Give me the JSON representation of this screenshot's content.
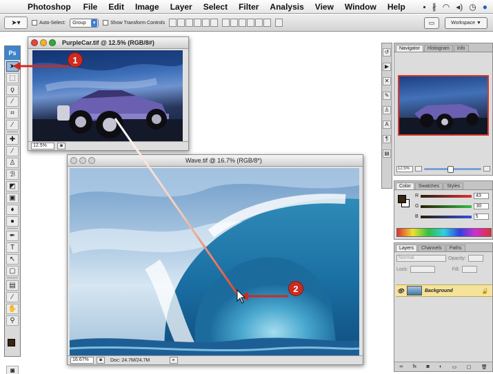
{
  "menubar": {
    "app_name": "Photoshop",
    "items": [
      "File",
      "Edit",
      "Image",
      "Layer",
      "Select",
      "Filter",
      "Analysis",
      "View",
      "Window",
      "Help"
    ],
    "status_icons": [
      "display-icon",
      "bluetooth-icon",
      "wifi-icon",
      "volume-icon",
      "clock-icon",
      "spotlight-icon"
    ]
  },
  "options_bar": {
    "auto_select_label": "Auto-Select:",
    "auto_select_value": "Group",
    "show_transform_label": "Show Transform Controls",
    "workspace_label": "Workspace ▼"
  },
  "toolbox": {
    "logo": "Ps",
    "tools": [
      "move-tool",
      "marquee-tool",
      "lasso-tool",
      "magic-wand-tool",
      "crop-tool",
      "slice-tool",
      "healing-brush-tool",
      "brush-tool",
      "clone-stamp-tool",
      "history-brush-tool",
      "eraser-tool",
      "gradient-tool",
      "blur-tool",
      "dodge-tool",
      "pen-tool",
      "type-tool",
      "path-selection-tool",
      "shape-tool",
      "notes-tool",
      "eyedropper-tool",
      "hand-tool",
      "zoom-tool"
    ],
    "active_tool": "move-tool"
  },
  "windows": {
    "car": {
      "title": "PurpleCar.tif @ 12.5% (RGB/8#)",
      "zoom": "12.5%"
    },
    "wave": {
      "title": "Wave.tif @ 16.7% (RGB/8*)",
      "zoom": "16.67%",
      "doc_info": "Doc: 24.7M/24.7M"
    }
  },
  "navigator": {
    "tabs": [
      "Navigator",
      "Histogram",
      "Info"
    ],
    "zoom": "12.5%"
  },
  "color_panel": {
    "tabs": [
      "Color",
      "Swatches",
      "Styles"
    ],
    "channels": [
      {
        "label": "R",
        "value": "43",
        "color": "#c63a34"
      },
      {
        "label": "G",
        "value": "30",
        "color": "#3d9f3d"
      },
      {
        "label": "B",
        "value": "5",
        "color": "#3d5fc6"
      }
    ],
    "foreground_color": "#3b2410"
  },
  "layers_panel": {
    "tabs": [
      "Layers",
      "Channels",
      "Paths"
    ],
    "blend_mode": "Normal",
    "opacity_label": "Opacity:",
    "lock_label": "Lock:",
    "fill_label": "Fill:",
    "layer_name": "Background"
  },
  "callouts": [
    "1",
    "2"
  ],
  "colors": {
    "callout_red": "#cd2b20",
    "selection_yellow": "#f6e39a"
  }
}
